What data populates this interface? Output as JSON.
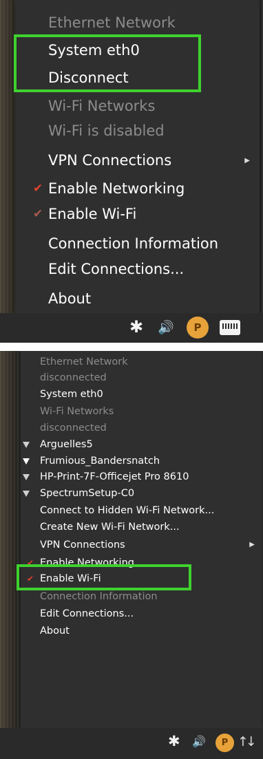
{
  "top_menu": {
    "items": [
      {
        "label": "Ethernet Network",
        "state": "disabled"
      },
      {
        "label": "System eth0"
      },
      {
        "label": "Disconnect"
      },
      {
        "label": "Wi-Fi Networks",
        "state": "disabled"
      },
      {
        "label": "Wi-Fi is disabled",
        "state": "disabled"
      },
      {
        "label": "VPN Connections",
        "submenu": true
      },
      {
        "label": "Enable Networking",
        "checked": true
      },
      {
        "label": "Enable Wi-Fi",
        "checked": false
      },
      {
        "label": "Connection Information"
      },
      {
        "label": "Edit Connections..."
      },
      {
        "label": "About"
      }
    ]
  },
  "bottom_menu": {
    "items": [
      {
        "label": "Ethernet Network",
        "state": "disabled"
      },
      {
        "label": "disconnected",
        "state": "disabled"
      },
      {
        "label": "System eth0"
      },
      {
        "label": "Wi-Fi Networks",
        "state": "disabled"
      },
      {
        "label": "disconnected",
        "state": "disabled"
      },
      {
        "label": "Arguelles5",
        "icon": "wifi-signal-icon"
      },
      {
        "label": "Frumious_Bandersnatch",
        "icon": "wifi-signal-icon"
      },
      {
        "label": "HP-Print-7F-Officejet Pro 8610",
        "icon": "wifi-signal-icon"
      },
      {
        "label": "SpectrumSetup-C0",
        "icon": "wifi-signal-icon"
      },
      {
        "label": "Connect to Hidden Wi-Fi Network..."
      },
      {
        "label": "Create New Wi-Fi Network..."
      },
      {
        "label": "VPN Connections",
        "submenu": true
      },
      {
        "label": "Enable Networking",
        "checked": true
      },
      {
        "label": "Enable Wi-Fi",
        "checked": true
      },
      {
        "label": "Connection Information",
        "state": "disabled"
      },
      {
        "label": "Edit Connections..."
      },
      {
        "label": "About"
      }
    ]
  },
  "glyphs": {
    "check": "✔",
    "submenu_arrow": "▶",
    "bluetooth": "✱",
    "volume": "🔊",
    "p_badge": "P",
    "up_down_arrows": "↑↓"
  },
  "colors": {
    "menu_bg": "#2f2f2f",
    "highlight": "#3fd12f",
    "check": "#e0412e",
    "disabled_text": "#8c8c8c",
    "badge": "#e7a23a"
  },
  "icons": [
    "bluetooth-icon",
    "volume-icon",
    "p-badge-icon",
    "wired-network-icon",
    "network-activity-icon"
  ]
}
